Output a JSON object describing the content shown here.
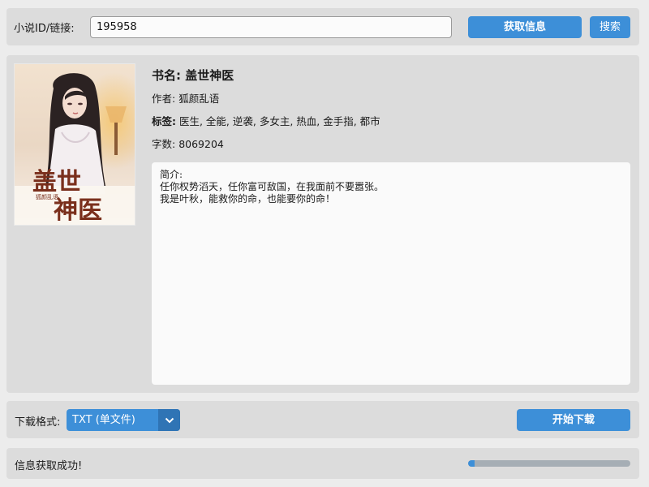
{
  "top_bar": {
    "id_label": "小说ID/链接:",
    "id_value": "195958",
    "fetch_button": "获取信息",
    "search_button": "搜索"
  },
  "book": {
    "cover_title": "盖世神医",
    "cover_subtitle": "狐颜乱语",
    "title_label": "书名:",
    "title": "盖世神医",
    "author_label": "作者:",
    "author": "狐颜乱语",
    "tags_label": "标签:",
    "tags": "医生, 全能, 逆袭, 多女主, 热血, 金手指, 都市",
    "words_label": "字数:",
    "words": "8069204",
    "synopsis_label": "简介:",
    "synopsis_lines": [
      "任你权势滔天，任你富可敌国，在我面前不要嚣张。",
      "我是叶秋，能救你的命，也能要你的命！"
    ]
  },
  "download": {
    "format_label": "下载格式:",
    "format_selected": "TXT (单文件)",
    "start_button": "开始下载"
  },
  "status": {
    "message": "信息获取成功!",
    "progress": 0.04
  },
  "colors": {
    "accent": "#3d8fd8",
    "panel": "#dcdcdc",
    "background": "#ececec"
  },
  "icons": {
    "dropdown": "chevron-down-icon"
  }
}
